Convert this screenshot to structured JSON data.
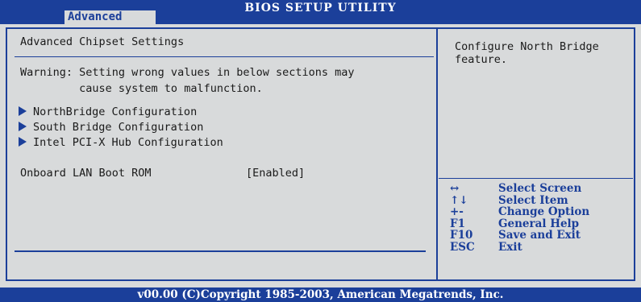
{
  "header": {
    "title": "BIOS SETUP UTILITY",
    "active_tab": "Advanced"
  },
  "main": {
    "section_title": "Advanced Chipset Settings",
    "warning_line1": "Warning: Setting wrong values in below sections may",
    "warning_line2": "         cause system to malfunction.",
    "menu_items": [
      {
        "label": "NorthBridge Configuration"
      },
      {
        "label": "South Bridge Configuration"
      },
      {
        "label": "Intel PCI-X Hub Configuration"
      }
    ],
    "settings": [
      {
        "name": "Onboard LAN Boot ROM",
        "value": "[Enabled]"
      }
    ]
  },
  "help": {
    "description": "Configure North Bridge feature.",
    "keys": [
      {
        "key": "↔",
        "action": "Select Screen"
      },
      {
        "key": "↑↓",
        "action": "Select Item"
      },
      {
        "key": "+-",
        "action": "Change Option"
      },
      {
        "key": "F1",
        "action": "General Help"
      },
      {
        "key": "F10",
        "action": "Save and Exit"
      },
      {
        "key": "ESC",
        "action": "Exit"
      }
    ]
  },
  "footer": {
    "copyright": "v00.00 (C)Copyright 1985-2003, American Megatrends, Inc."
  },
  "colors": {
    "accent": "#1b3f9a",
    "background": "#d8dadb"
  }
}
